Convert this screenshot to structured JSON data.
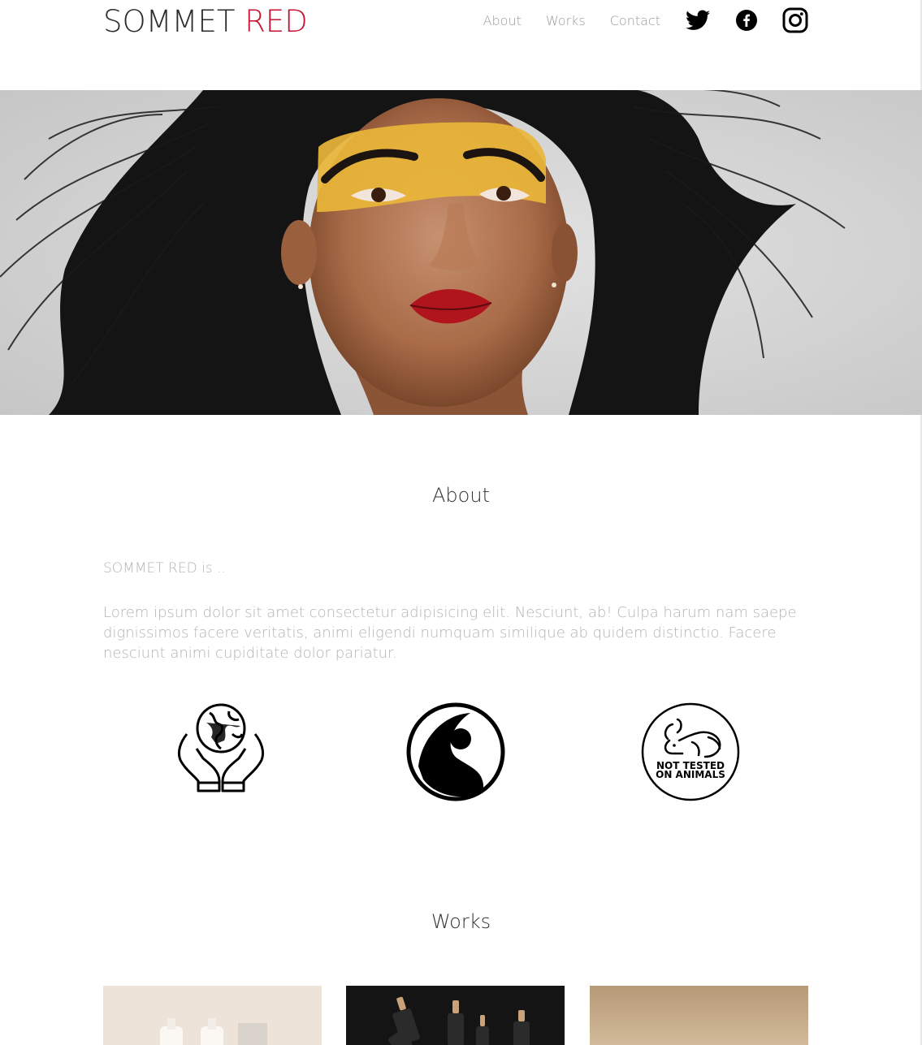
{
  "brand": {
    "name_part1": "SOMMET",
    "name_part2": "RED",
    "accent_color": "#c8102e"
  },
  "nav": {
    "items": [
      {
        "label": "About"
      },
      {
        "label": "Works"
      },
      {
        "label": "Contact"
      }
    ],
    "social": [
      {
        "icon": "twitter-icon"
      },
      {
        "icon": "facebook-icon"
      },
      {
        "icon": "instagram-icon"
      }
    ]
  },
  "about": {
    "title": "About",
    "intro": "SOMMET RED is ..",
    "body": "Lorem ipsum dolor sit amet consectetur adipisicing elit. Nesciunt, ab! Culpa harum nam saepe dignissimos facere veritatis, animi eligendi numquam similique ab quidem distinctio. Facere nesciunt animi cupiditate dolor pariatur.",
    "badges": [
      {
        "icon": "hands-globe-icon"
      },
      {
        "icon": "fairtrade-icon"
      },
      {
        "icon": "cruelty-free-rabbit-icon",
        "line1": "NOT TESTED",
        "line2": "ON ANIMALS"
      }
    ]
  },
  "works": {
    "title": "Works"
  }
}
